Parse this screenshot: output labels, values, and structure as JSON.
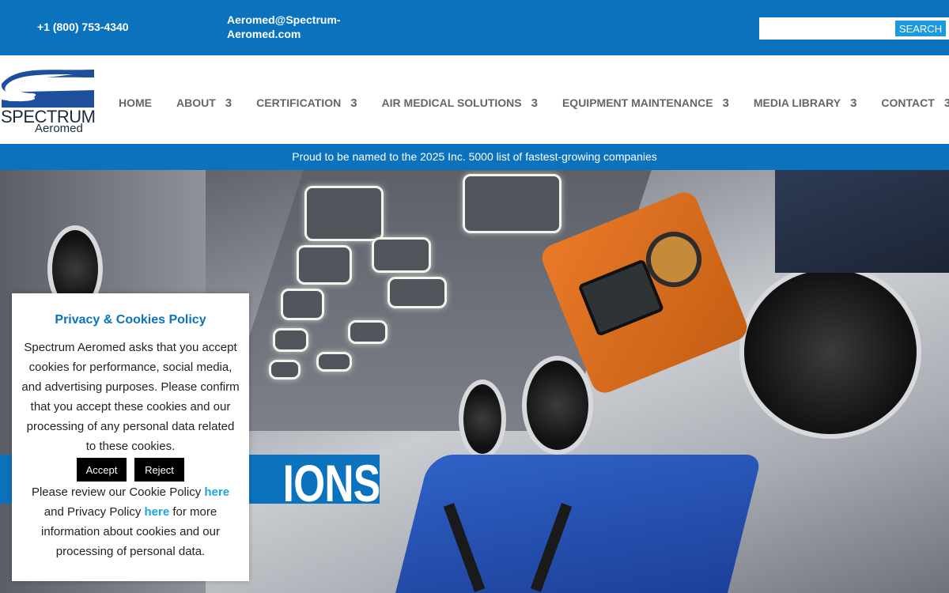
{
  "topbar": {
    "phone": "+1 (800) 753-4340",
    "email_line1": "Aeromed@Spectrum-",
    "email_line2": "Aeromed.com",
    "search_placeholder": "",
    "search_button": "SEARCH"
  },
  "logo": {
    "word1": "SPECTRUM",
    "word2": "Aeromed"
  },
  "nav": {
    "items": [
      {
        "label": "HOME",
        "has_dropdown": false
      },
      {
        "label": "ABOUT",
        "has_dropdown": true
      },
      {
        "label": "CERTIFICATION",
        "has_dropdown": true
      },
      {
        "label": "AIR MEDICAL SOLUTIONS",
        "has_dropdown": true
      },
      {
        "label": "EQUIPMENT MAINTENANCE",
        "has_dropdown": true
      },
      {
        "label": "MEDIA LIBRARY",
        "has_dropdown": true
      },
      {
        "label": "CONTACT",
        "has_dropdown": true
      }
    ],
    "dropdown_glyph": "3"
  },
  "announcement": "Proud to be named to the 2025 Inc. 5000 list of fastest-growing companies",
  "hero": {
    "banner_text": "IONS"
  },
  "cookie": {
    "title": "Privacy & Cookies Policy",
    "body": "Spectrum Aeromed asks that you accept cookies for performance, social media, and advertising purposes. Please confirm that you accept these cookies and our processing of any personal data related to these cookies.",
    "accept": "Accept",
    "reject": "Reject",
    "review_1": "Please review our Cookie Policy ",
    "link_1": "here",
    "review_2": " and Privacy Policy ",
    "link_2": "here",
    "review_3": " for more information about cookies and our processing of personal data."
  },
  "colors": {
    "brand_blue": "#0b72bd",
    "link_blue": "#1aa5e0",
    "nav_gray": "#666666"
  }
}
